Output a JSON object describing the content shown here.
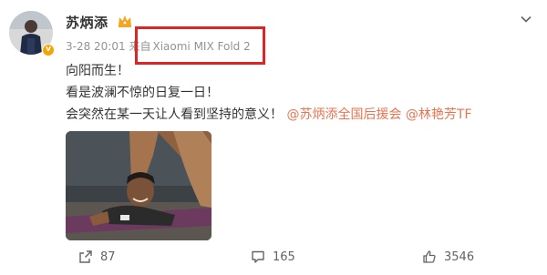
{
  "post": {
    "author": "苏炳添",
    "meta": {
      "time": "3-28 20:01",
      "source_prefix": "来自",
      "device": "Xiaomi MIX Fold 2"
    },
    "lines": [
      "向阳而生！",
      "看是波澜不惊的日复一日！",
      "会突然在某一天让人看到坚持的意义！"
    ],
    "mentions": [
      "@苏炳添全国后援会",
      "@林艳芳TF"
    ],
    "verified_mark": "v"
  },
  "actions": {
    "share_count": "87",
    "comment_count": "165",
    "like_count": "3546"
  },
  "colors": {
    "mention": "#eb7350",
    "highlight_box": "#e02424",
    "meta_text": "#939393"
  },
  "icons": [
    "crown-icon",
    "chevron-down-icon",
    "share-icon",
    "comment-icon",
    "like-icon"
  ]
}
